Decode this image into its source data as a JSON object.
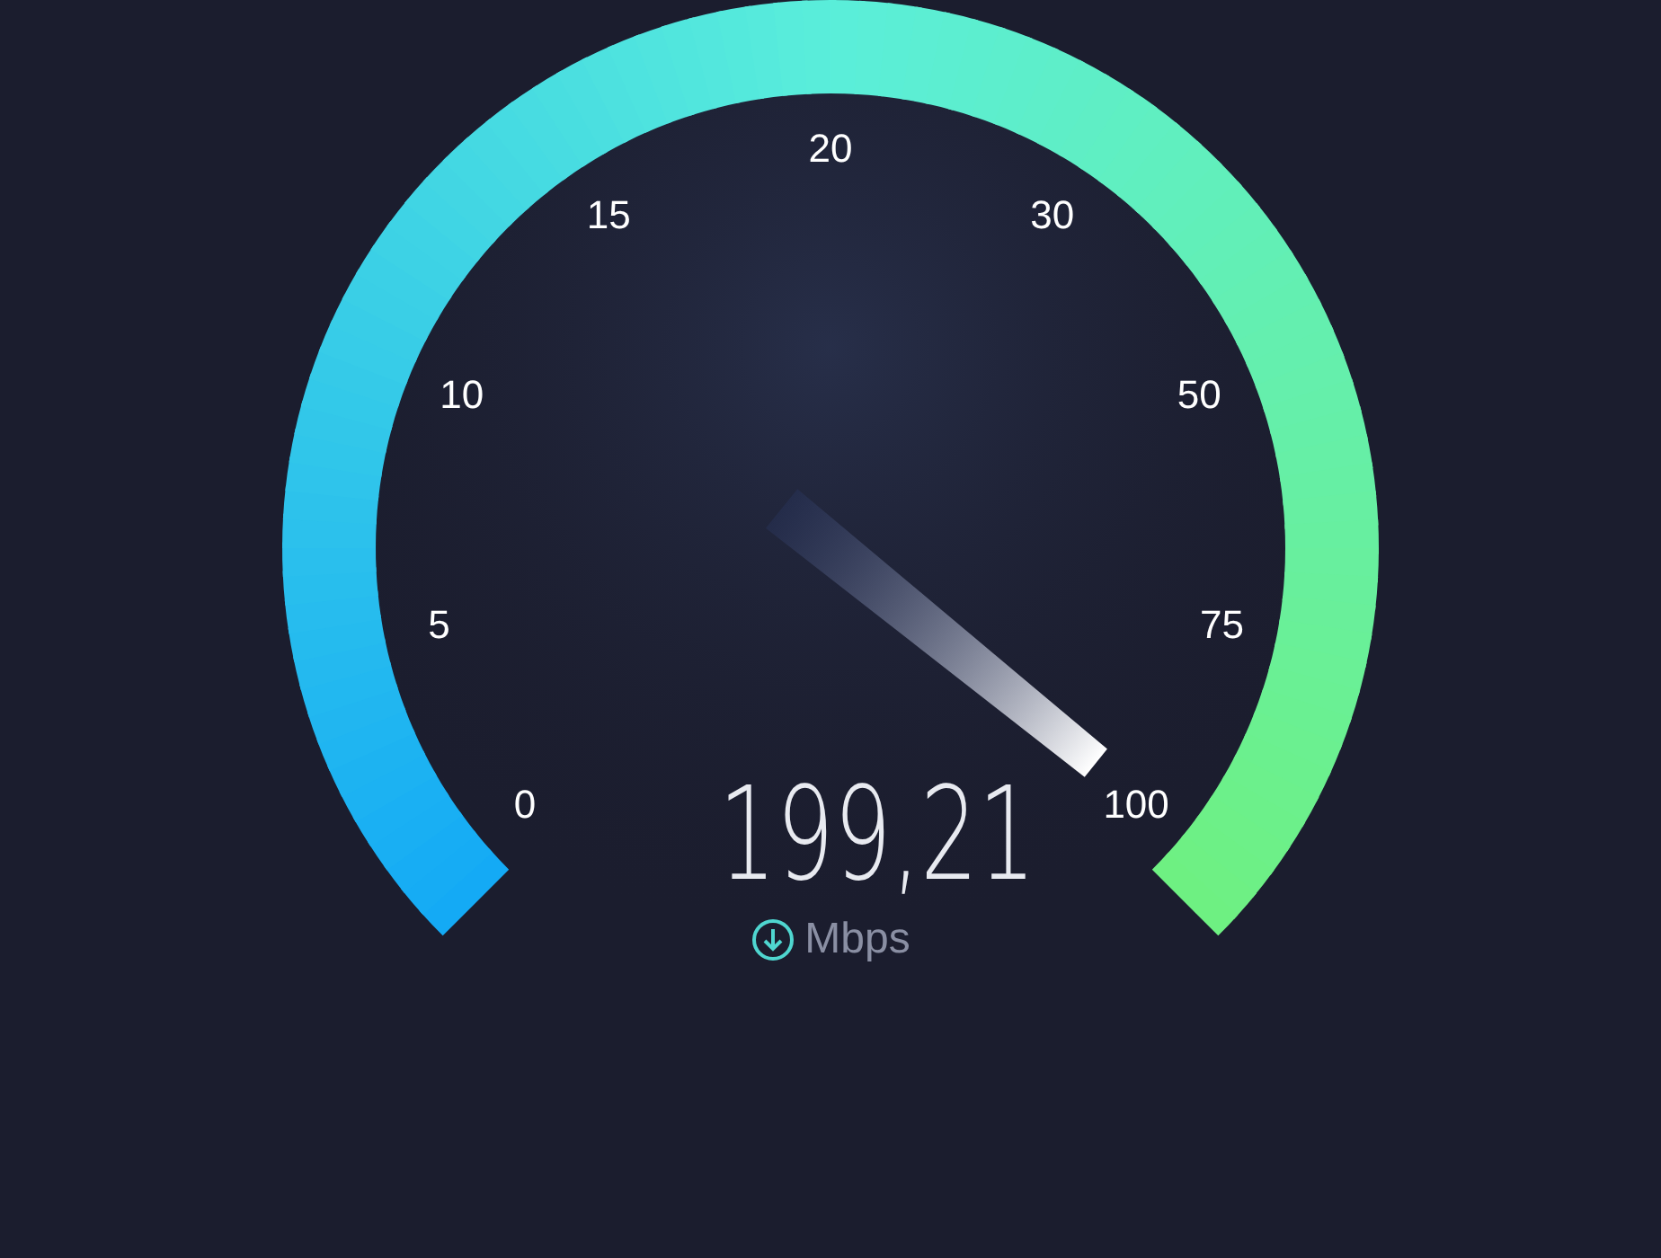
{
  "gauge": {
    "scale": [
      "0",
      "5",
      "10",
      "15",
      "20",
      "30",
      "50",
      "75",
      "100"
    ]
  },
  "reading": {
    "value": "199,21",
    "unit": "Mbps"
  }
}
